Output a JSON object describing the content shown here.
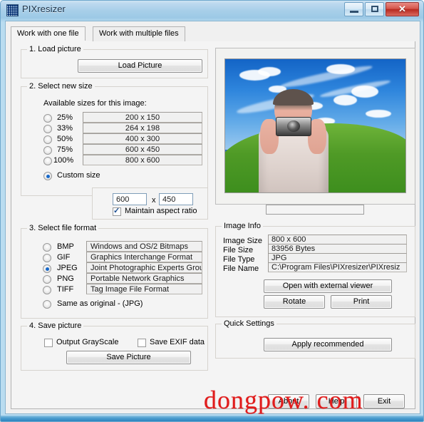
{
  "window": {
    "title": "PIXresizer",
    "icon": "pixresizer-app-icon",
    "buttons": {
      "minimize": "minimize-icon",
      "maximize": "maximize-icon",
      "close": "✕"
    }
  },
  "tabs": [
    {
      "label": "Work with one file",
      "active": true
    },
    {
      "label": "Work with multiple files",
      "active": false
    }
  ],
  "load_picture": {
    "legend": "1. Load picture",
    "button": "Load Picture"
  },
  "select_size": {
    "legend": "2. Select new size",
    "available_label": "Available sizes for this image:",
    "options": [
      {
        "percent": "25%",
        "size": "200 x 150",
        "selected": false
      },
      {
        "percent": "33%",
        "size": "264 x 198",
        "selected": false
      },
      {
        "percent": "50%",
        "size": "400 x 300",
        "selected": false
      },
      {
        "percent": "75%",
        "size": "600 x 450",
        "selected": false
      },
      {
        "percent": "100%",
        "size": "800 x 600",
        "selected": false
      }
    ],
    "custom_label": "Custom size",
    "custom_selected": true,
    "custom_width": "600",
    "custom_separator": "x",
    "custom_height": "450",
    "maintain_aspect_label": "Maintain aspect ratio",
    "maintain_aspect_checked": true
  },
  "file_format": {
    "legend": "3. Select file format",
    "options": [
      {
        "name": "BMP",
        "desc": "Windows and OS/2 Bitmaps",
        "selected": false
      },
      {
        "name": "GIF",
        "desc": "Graphics Interchange Format",
        "selected": false
      },
      {
        "name": "JPEG",
        "desc": "Joint Photographic Experts Group",
        "selected": true
      },
      {
        "name": "PNG",
        "desc": "Portable Network Graphics",
        "selected": false
      },
      {
        "name": "TIFF",
        "desc": "Tag Image File Format",
        "selected": false
      }
    ],
    "same_as_original_label": "Same as original  - (JPG)",
    "same_as_original_selected": false
  },
  "save_picture": {
    "legend": "4. Save picture",
    "grayscale_label": "Output GrayScale",
    "grayscale_checked": false,
    "exif_label": "Save EXIF data",
    "exif_checked": false,
    "button": "Save Picture"
  },
  "preview": {
    "name": "image-preview",
    "description": "photographer holding a camera in front of a green hill and blue sky"
  },
  "image_info": {
    "legend": "Image Info",
    "rows": [
      {
        "label": "Image Size",
        "value": "800 x 600"
      },
      {
        "label": "File Size",
        "value": "83956 Bytes"
      },
      {
        "label": "File Type",
        "value": "JPG"
      },
      {
        "label": "File Name",
        "value": "C:\\Program Files\\PIXresizer\\PIXresiz"
      }
    ],
    "buttons": {
      "open_external": "Open with external viewer",
      "rotate": "Rotate",
      "print": "Print"
    }
  },
  "quick_settings": {
    "legend": "Quick Settings",
    "button": "Apply recommended"
  },
  "bottom_buttons": {
    "about": "About",
    "help": "Help",
    "exit": "Exit"
  },
  "watermark": "dongpow. com",
  "colors": {
    "accent": "#1668c9",
    "close_button": "#b82a20",
    "watermark": "#e01b1b",
    "panel": "#f4f4f4"
  }
}
